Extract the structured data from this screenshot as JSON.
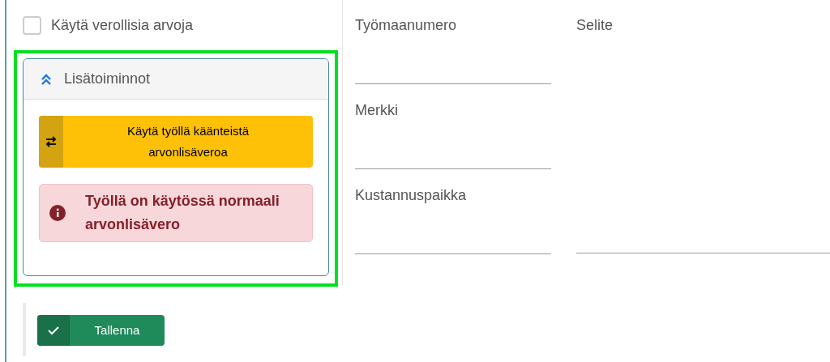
{
  "checkbox": {
    "label": "Käytä verollisia arvoja",
    "checked": false
  },
  "panel": {
    "title": "Lisätoiminnot",
    "expanded": true,
    "action_button": "Käytä työllä käänteistä arvonlisäveroa",
    "alert": "Työllä on käytössä normaali arvonlisävero"
  },
  "fields": [
    {
      "label": "Työmaanumero"
    },
    {
      "label": "Merkki"
    },
    {
      "label": "Kustannuspaikka"
    }
  ],
  "description_field": {
    "label": "Selite"
  },
  "save_button": "Tallenna"
}
